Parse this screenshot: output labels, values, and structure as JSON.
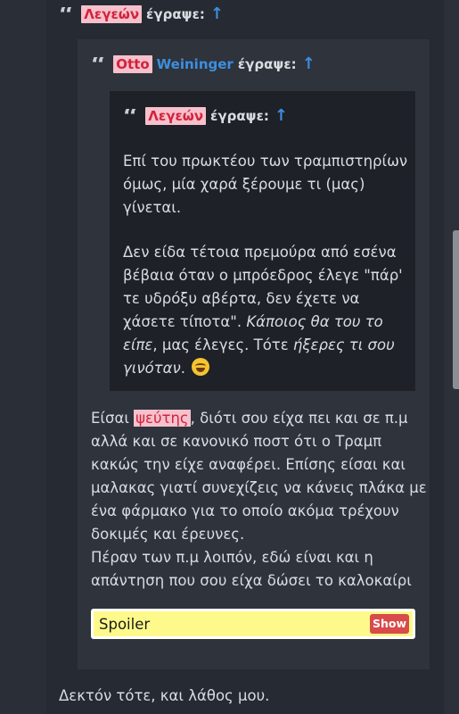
{
  "quotes": [
    {
      "author_parts": [
        "Λεγεών"
      ],
      "wrote_label": "έγραψε:",
      "arrow": "↑"
    },
    {
      "author_parts": [
        "Otto",
        "Weininger"
      ],
      "wrote_label": "έγραψε:",
      "arrow": "↑"
    },
    {
      "author_parts": [
        "Λεγεών"
      ],
      "wrote_label": "έγραψε:",
      "arrow": "↑",
      "paragraph_1": [
        "Επί του πρωκτέου των τραμπιστηρίων",
        "όμως, μία χαρά ξέρουμε τι (μας)",
        "γίνεται."
      ],
      "paragraph_2": {
        "line1": "Δεν είδα τέτοια πρεμούρα από εσένα",
        "line2": "βέβαια όταν ο μπρόεδρος έλεγε \"πάρ'",
        "line3": "τε υδρόξυ αβέρτα, δεν έχετε να",
        "line4_plain": "χάσετε τίποτα\". ",
        "line4_italic": "Κάποιος θα του το",
        "line5_italic": "είπε",
        "line5_plain": ", μας έλεγες. Τότε ",
        "line5_italic_2": "ήξερες τι σου",
        "line6_italic": "γινόταν",
        "line6_plain": ".",
        "emoji": "laughing-emoji"
      }
    }
  ],
  "reply": {
    "line1_start": "Είσαι ",
    "line1_highlight": "ψεύτης",
    "line1_end": ", διότι σου είχα πει και σε π.μ",
    "line2": "αλλά και σε κανονικό ποστ ότι ο Τραμπ",
    "line3": "κακώς την είχε αναφέρει. Επίσης είσαι και",
    "line4": "μαλακας γιατί συνεχίζεις να κάνεις πλάκα με",
    "line5": "ένα φάρμακο για το οποίο ακόμα τρέχουν",
    "line6": "δοκιμές και έρευνες.",
    "line7": "Πέραν των π.μ λοιπόν, εδώ είναι και η",
    "line8": "απάντηση που σου είχα δώσει το καλοκαίρι"
  },
  "spoiler": {
    "label": "Spoiler",
    "button": "Show"
  },
  "footer": "Δεκτόν τότε, και λάθος μου.",
  "colors": {
    "background": "#2a2e37",
    "quote_box_2": "#2f333c",
    "quote_box_3": "#1e2127",
    "name_highlight_bg": "#f6c0cc",
    "name_highlight_fg": "#d1233a",
    "link_blue": "#3d8fe0",
    "spoiler_bg": "#fdf98a",
    "spoiler_button": "#d94a4a"
  },
  "icons": {
    "quote": "quote-icon",
    "arrow": "up-arrow-icon"
  }
}
